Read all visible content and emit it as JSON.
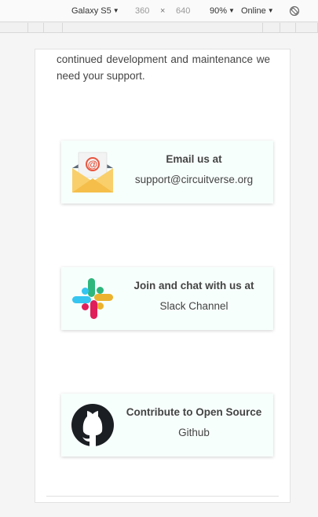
{
  "devtools": {
    "device": "Galaxy S5",
    "width": "360",
    "separator": "×",
    "height": "640",
    "zoom": "90%",
    "network": "Online",
    "caret": "▼",
    "rotate_icon": "rotate-icon"
  },
  "page": {
    "intro_text": "continued development and maintenance we need your support."
  },
  "cards": {
    "email": {
      "title": "Email us at",
      "subtitle": "support@circuitverse.org",
      "icon": "email-envelope-icon"
    },
    "slack": {
      "title": "Join and chat with us at",
      "subtitle": "Slack Channel",
      "icon": "slack-icon"
    },
    "github": {
      "title": "Contribute to Open Source",
      "subtitle": "Github",
      "icon": "github-icon"
    }
  },
  "colors": {
    "card_background": "#f7fffc",
    "text": "#444444",
    "email_at": "#e8553e",
    "envelope": "#f9cf6b",
    "slack_blue": "#36c5f0",
    "slack_green": "#2eb67d",
    "slack_yellow": "#ecb22e",
    "slack_red": "#e01e5a",
    "github": "#1b1f23"
  }
}
